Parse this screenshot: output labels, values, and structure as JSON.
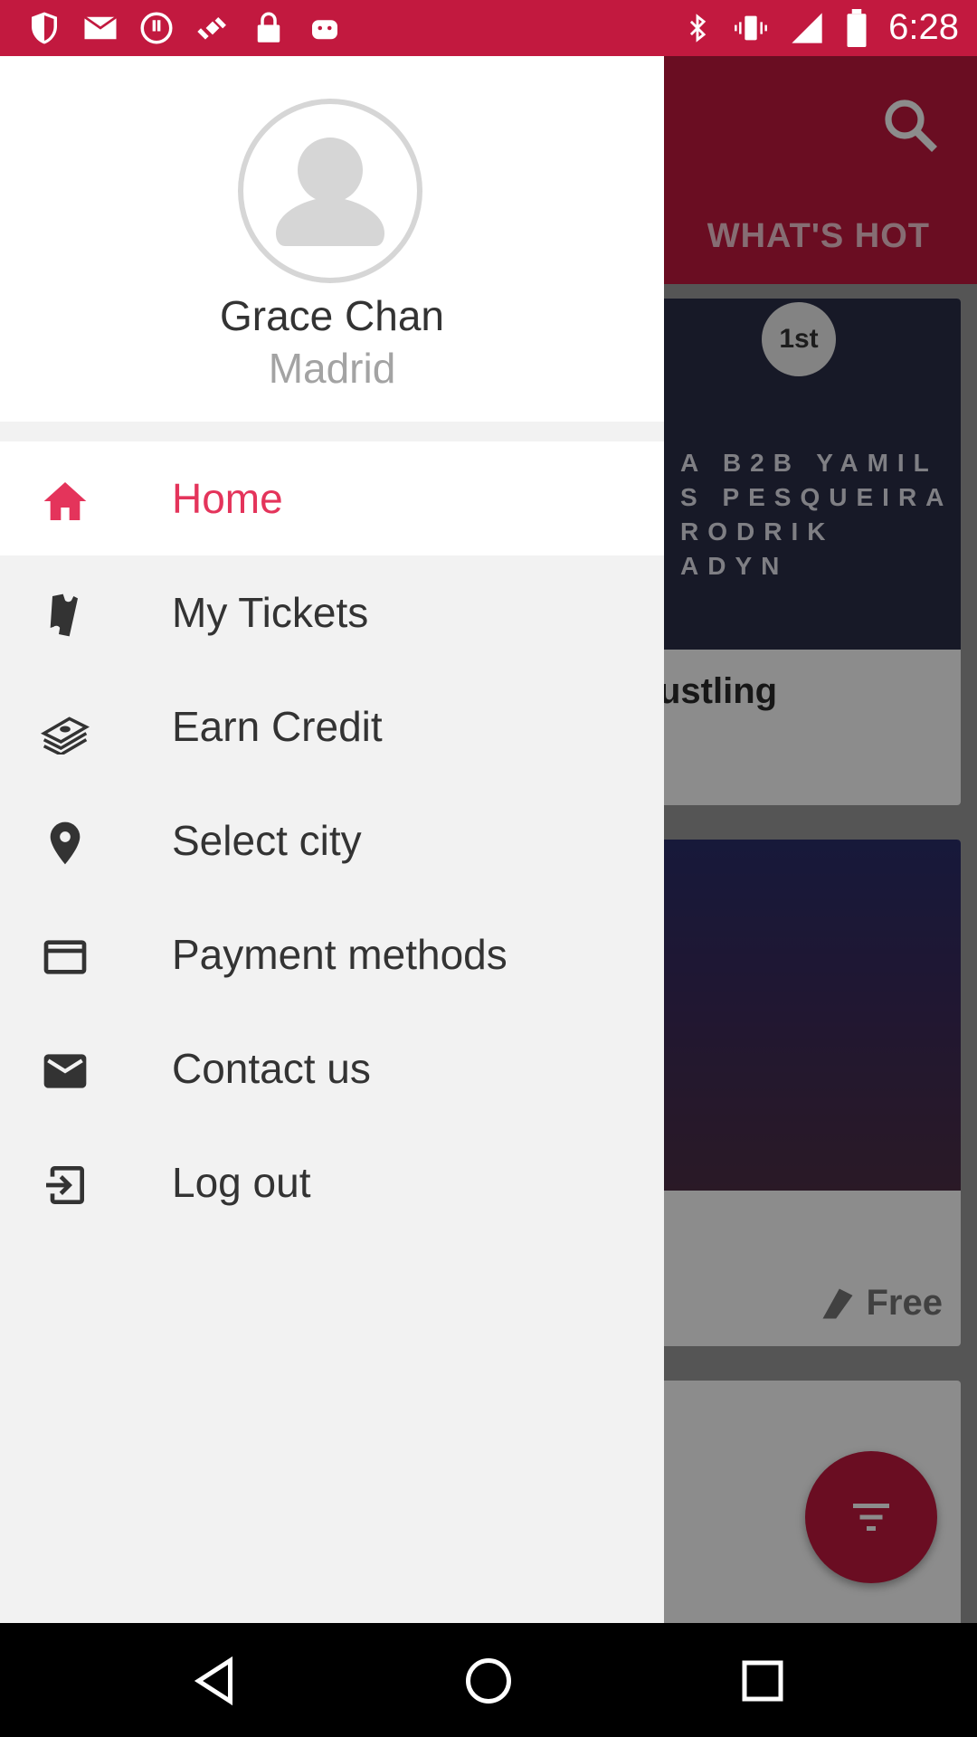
{
  "status_bar": {
    "time": "6:28",
    "left_icons": [
      "shield-icon",
      "mail-icon",
      "alert-icon",
      "fake-gps-icon",
      "lock-icon",
      "android-icon"
    ],
    "right_icons": [
      "bluetooth-icon",
      "vibrate-icon",
      "signal-icon",
      "battery-icon"
    ]
  },
  "app": {
    "tab_label": "WHAT'S HOT",
    "card1": {
      "poster_badge": "1st",
      "poster_lines": [
        "A B2B YAMIL",
        "S PESQUEIRA",
        "RODRIK",
        "ADYN"
      ],
      "title": "ustling"
    },
    "card2": {
      "price": "Free"
    }
  },
  "drawer": {
    "user_name": "Grace Chan",
    "user_city": "Madrid",
    "menu": [
      {
        "label": "Home",
        "icon": "home-icon",
        "active": true
      },
      {
        "label": "My Tickets",
        "icon": "ticket-icon",
        "active": false
      },
      {
        "label": "Earn Credit",
        "icon": "money-icon",
        "active": false
      },
      {
        "label": "Select city",
        "icon": "location-pin-icon",
        "active": false
      },
      {
        "label": "Payment methods",
        "icon": "credit-card-icon",
        "active": false
      },
      {
        "label": "Contact us",
        "icon": "envelope-icon",
        "active": false
      },
      {
        "label": "Log out",
        "icon": "logout-icon",
        "active": false
      }
    ]
  },
  "colors": {
    "brand": "#c2193f",
    "active_text": "#e4345b"
  }
}
